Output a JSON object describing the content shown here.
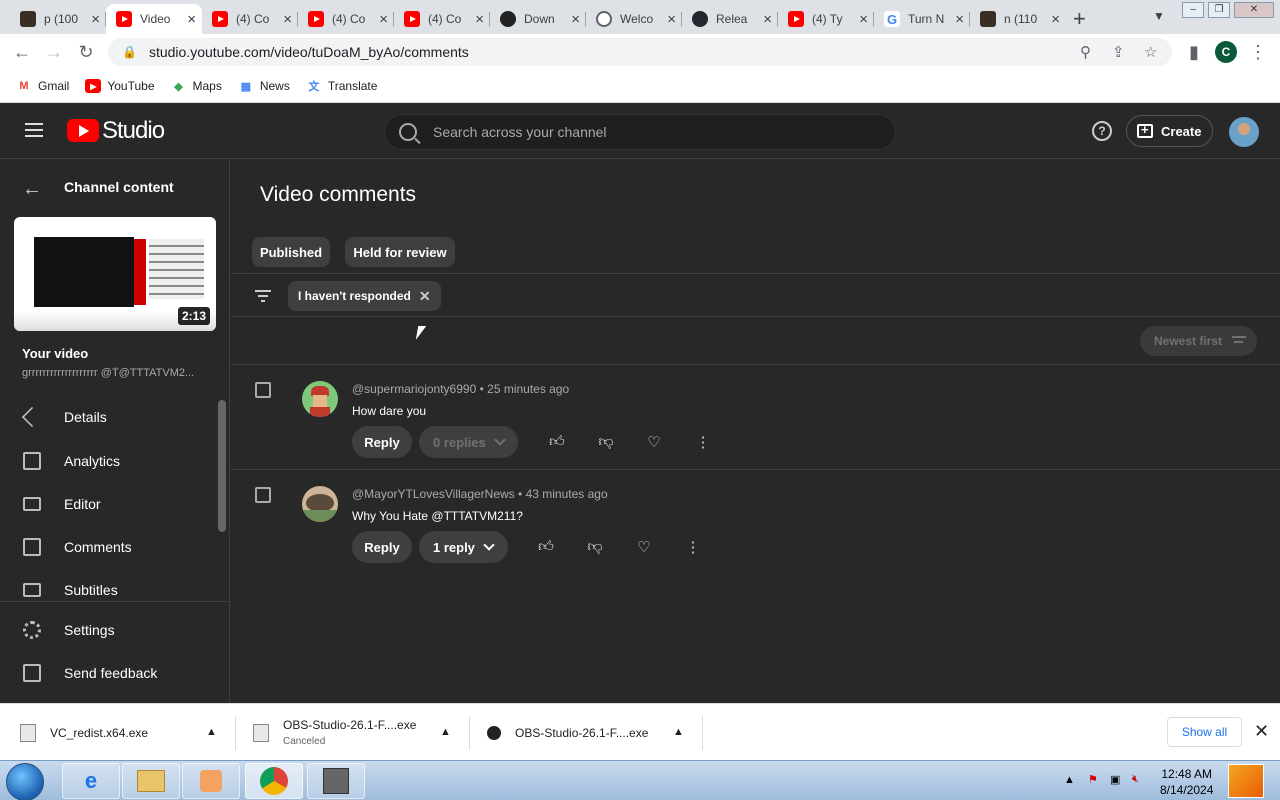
{
  "browser": {
    "tabs": [
      {
        "title": "p (100",
        "icon": "dark-thumbnail-favicon"
      },
      {
        "title": "Video",
        "icon": "youtube-favicon"
      },
      {
        "title": "(4) Co",
        "icon": "youtube-favicon"
      },
      {
        "title": "(4) Co",
        "icon": "youtube-favicon"
      },
      {
        "title": "(4) Co",
        "icon": "youtube-favicon"
      },
      {
        "title": "Down",
        "icon": "obs-favicon"
      },
      {
        "title": "Welco",
        "icon": "globe-favicon"
      },
      {
        "title": "Relea",
        "icon": "github-favicon"
      },
      {
        "title": "(4) Ty",
        "icon": "youtube-favicon"
      },
      {
        "title": "Turn N",
        "icon": "google-favicon"
      },
      {
        "title": "n (110",
        "icon": "dark-thumbnail-favicon"
      }
    ],
    "url": "studio.youtube.com/video/tuDoaM_byAo/comments",
    "profile_initial": "C",
    "bookmarks": [
      {
        "label": "Gmail",
        "icon": "gmail-icon",
        "color": "#ea4335"
      },
      {
        "label": "YouTube",
        "icon": "youtube-icon",
        "color": "#ff0000"
      },
      {
        "label": "Maps",
        "icon": "maps-icon",
        "color": "#34a853"
      },
      {
        "label": "News",
        "icon": "news-icon",
        "color": "#4285f4"
      },
      {
        "label": "Translate",
        "icon": "translate-icon",
        "color": "#4285f4"
      }
    ]
  },
  "header": {
    "logo_text": "Studio",
    "search_placeholder": "Search across your channel",
    "create_label": "Create"
  },
  "sidebar": {
    "back_label": "Channel content",
    "duration": "2:13",
    "video_heading": "Your video",
    "video_subtitle": "grrrrrrrrrrrrrrrrrrr @T̂@TTTATVM2...",
    "nav": [
      {
        "label": "Details",
        "icon": "pencil-icon"
      },
      {
        "label": "Analytics",
        "icon": "analytics-icon"
      },
      {
        "label": "Editor",
        "icon": "editor-icon"
      },
      {
        "label": "Comments",
        "icon": "comments-icon"
      },
      {
        "label": "Subtitles",
        "icon": "subtitles-icon"
      },
      {
        "label": "Settings",
        "icon": "gear-icon"
      },
      {
        "label": "Send feedback",
        "icon": "feedback-icon"
      }
    ]
  },
  "main": {
    "title": "Video comments",
    "tabs": [
      {
        "label": "Published"
      },
      {
        "label": "Held for review"
      }
    ],
    "filter_chip": "I haven't responded",
    "sort_label": "Newest first",
    "comments": [
      {
        "author": "@supermariojonty6990",
        "time": "25 minutes ago",
        "text": "How dare you",
        "reply_label": "Reply",
        "replies_label": "0 replies",
        "replies_enabled": false
      },
      {
        "author": "@MayorYTLovesVillagerNews",
        "time": "43 minutes ago",
        "text": "Why You Hate @TTTATVM211?",
        "reply_label": "Reply",
        "replies_label": "1 reply",
        "replies_enabled": true
      }
    ]
  },
  "downloads": {
    "items": [
      {
        "name": "VC_redist.x64.exe",
        "status": ""
      },
      {
        "name": "OBS-Studio-26.1-F....exe",
        "status": "Canceled"
      },
      {
        "name": "OBS-Studio-26.1-F....exe",
        "status": ""
      }
    ],
    "show_all_label": "Show all"
  },
  "taskbar": {
    "time": "12:48 AM",
    "date": "8/14/2024"
  },
  "colors": {
    "studio_bg": "#282828",
    "youtube_red": "#ff0000",
    "link_blue": "#1a73e8"
  }
}
